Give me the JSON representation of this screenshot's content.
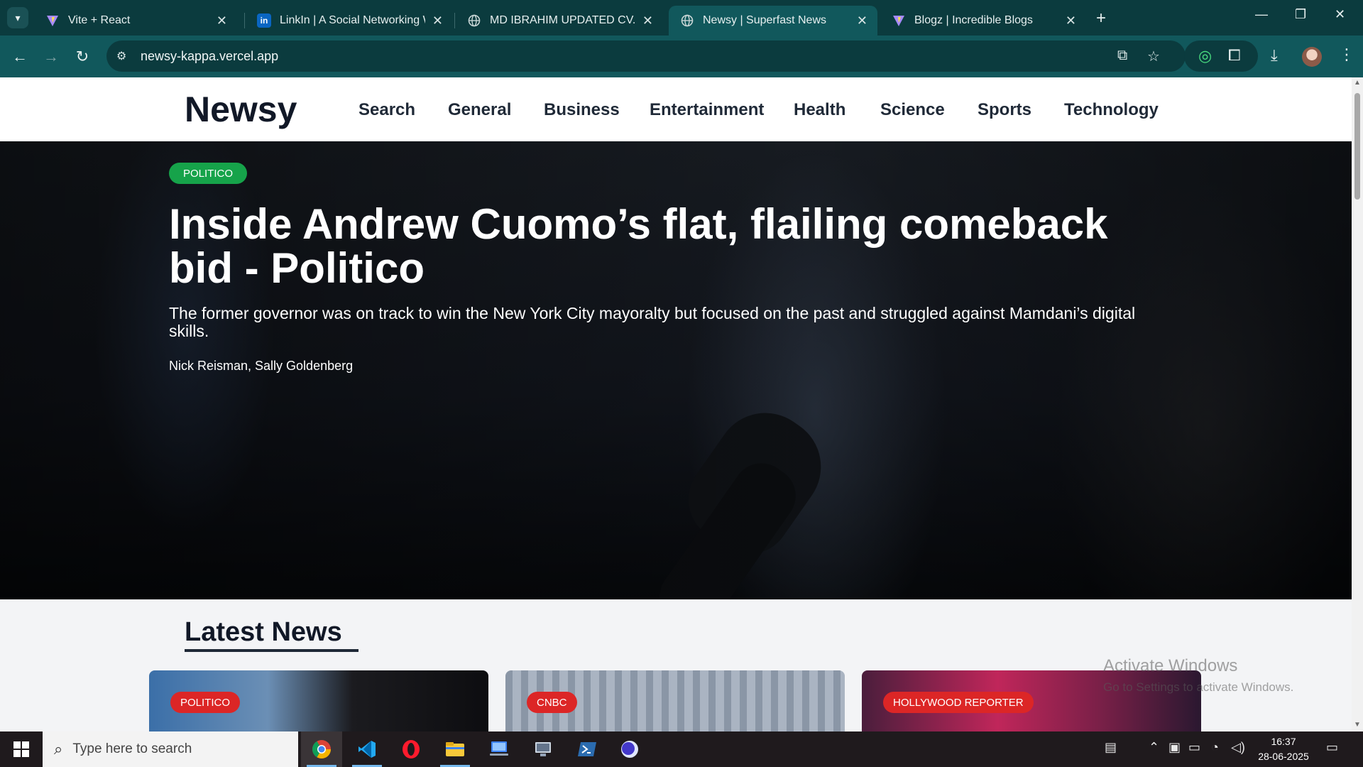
{
  "browser": {
    "tabs": [
      {
        "title": "Vite + React",
        "icon": "vite-icon",
        "active": false
      },
      {
        "title": "LinkIn | A Social Networking We",
        "icon": "linkedin-icon",
        "active": false
      },
      {
        "title": "MD IBRAHIM UPDATED CV.pdf",
        "icon": "globe-icon",
        "active": false
      },
      {
        "title": "Newsy | Superfast News",
        "icon": "globe-icon",
        "active": true
      },
      {
        "title": "Blogz | Incredible Blogs",
        "icon": "vite-icon",
        "active": false
      }
    ],
    "url": "newsy-kappa.vercel.app"
  },
  "site": {
    "logo": "Newsy",
    "nav": [
      "Search",
      "General",
      "Business",
      "Entertainment",
      "Health",
      "Science",
      "Sports",
      "Technology"
    ]
  },
  "hero": {
    "source": "POLITICO",
    "title": "Inside Andrew Cuomo’s flat, flailing comeback bid - Politico",
    "description": "The former governor was on track to win the New York City mayoralty but focused on the past and struggled against Mamdani’s digital skills.",
    "authors": "Nick Reisman, Sally Goldenberg"
  },
  "latest": {
    "heading": "Latest News",
    "cards": [
      {
        "source": "POLITICO"
      },
      {
        "source": "CNBC"
      },
      {
        "source": "HOLLYWOOD REPORTER"
      }
    ]
  },
  "watermark": {
    "line1": "Activate Windows",
    "line2": "Go to Settings to activate Windows."
  },
  "taskbar": {
    "search_placeholder": "Type here to search",
    "time": "16:37",
    "date": "28-06-2025"
  },
  "colors": {
    "chrome_dark": "#0b3b3e",
    "chrome_toolbar": "#11585c",
    "hero_badge": "#16a34a",
    "card_badge": "#dc2626"
  }
}
